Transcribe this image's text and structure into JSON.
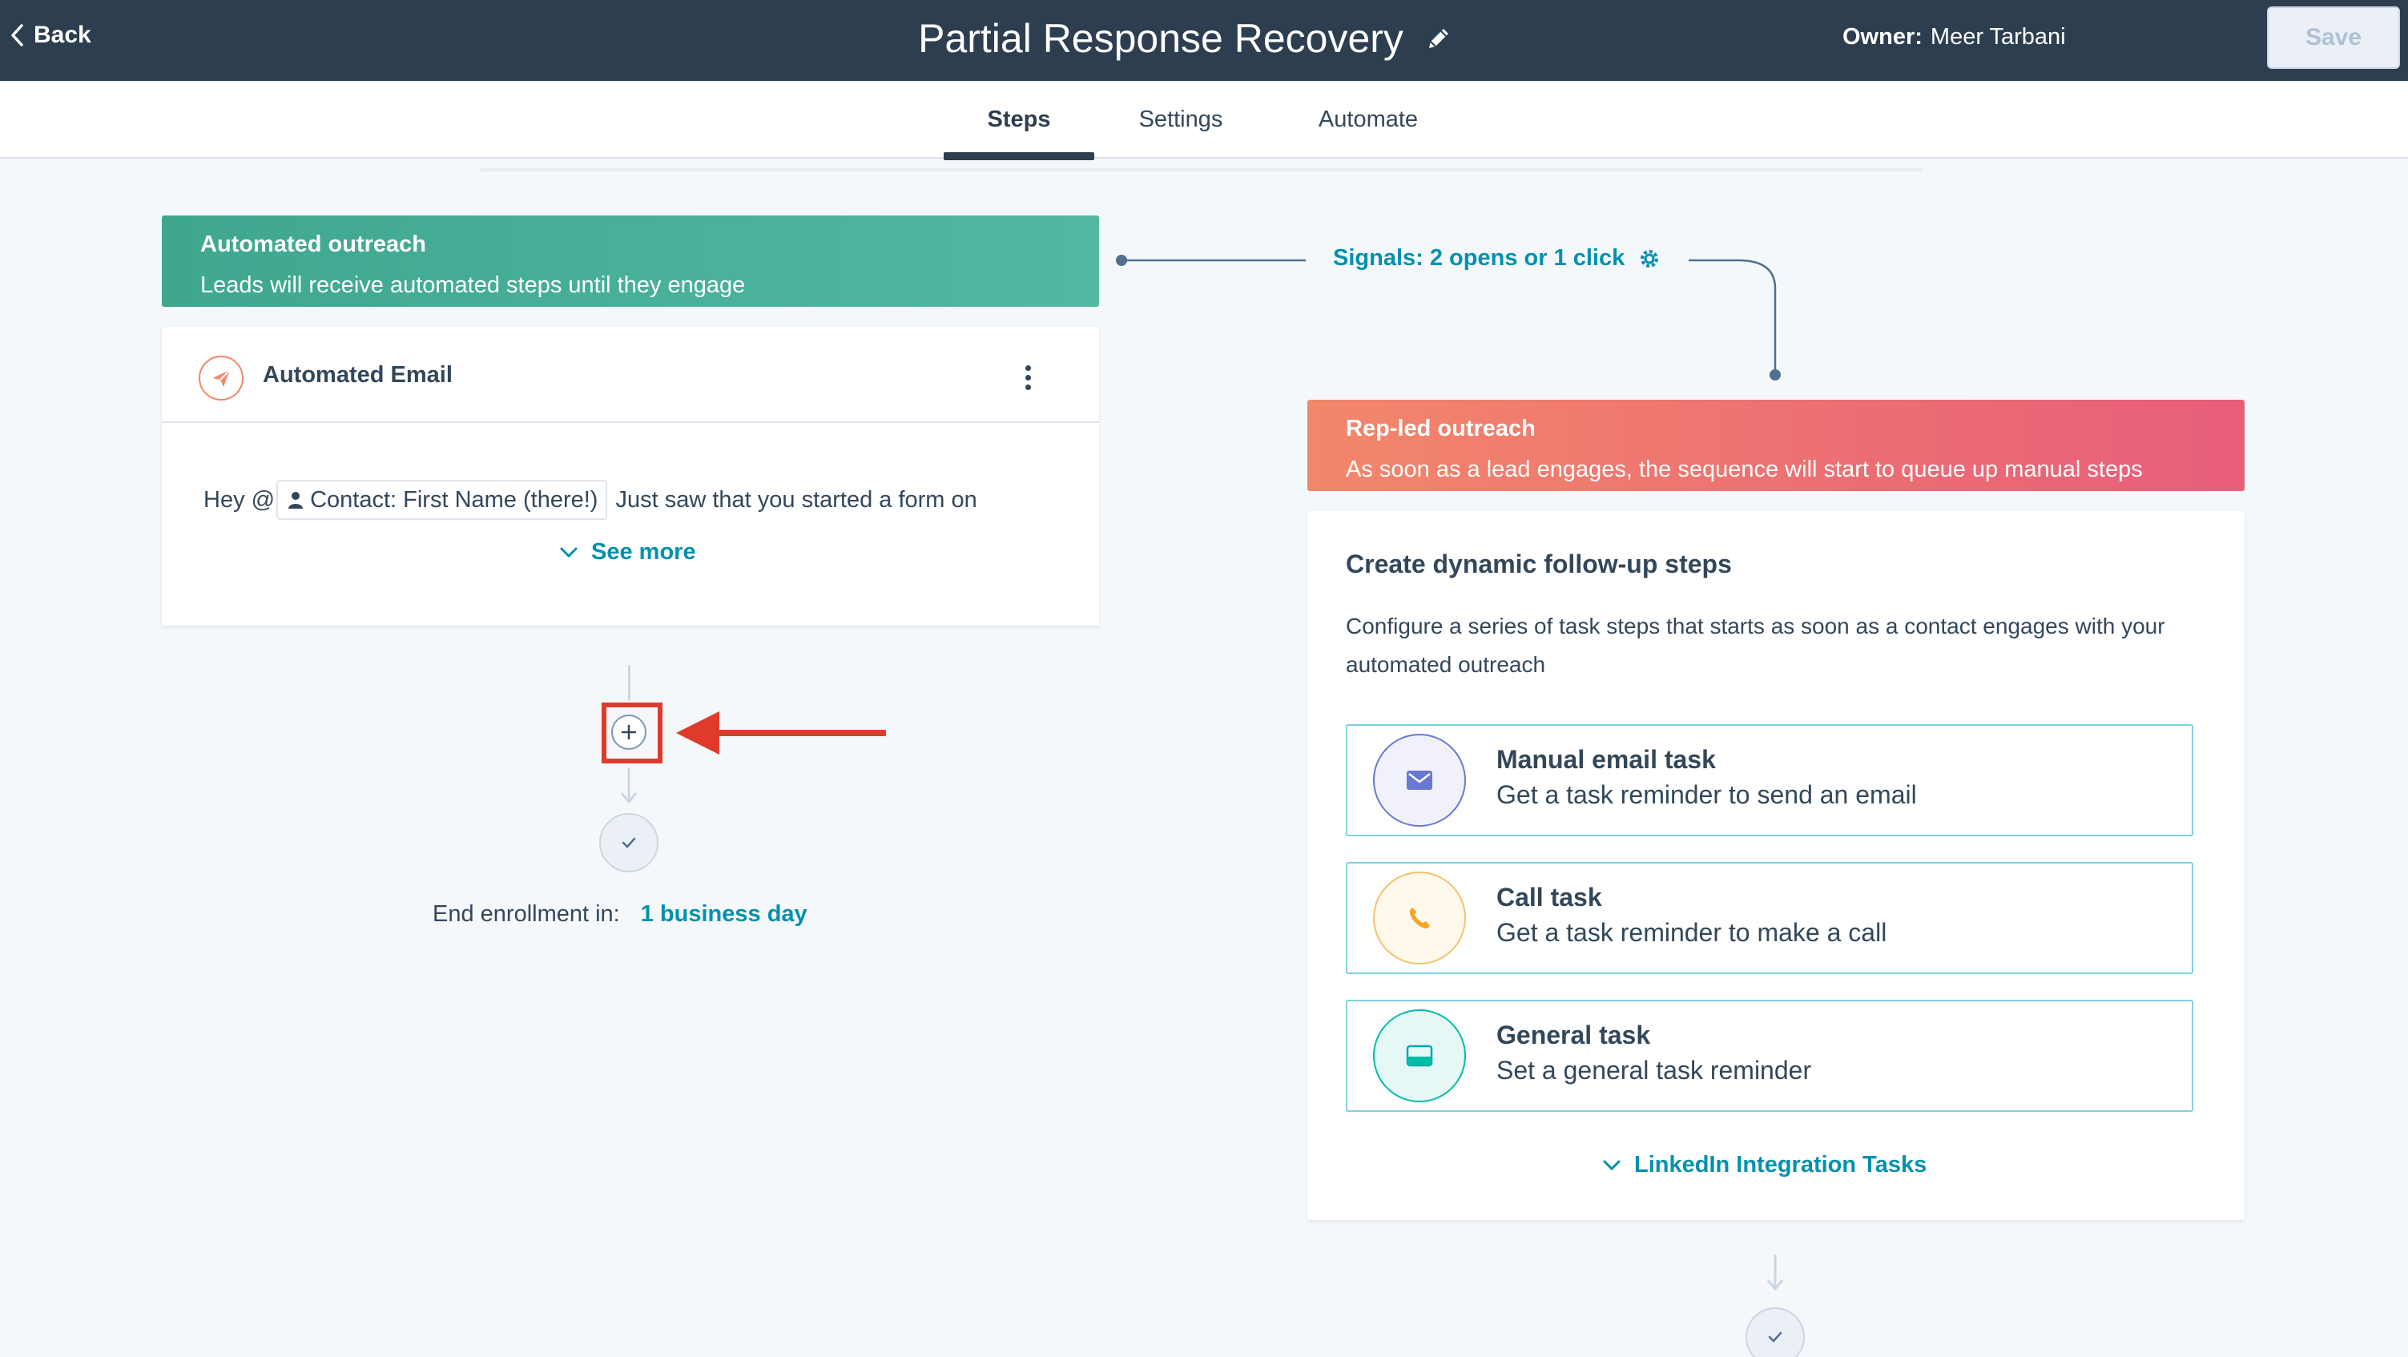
{
  "topbar": {
    "back_label": "Back",
    "title": "Partial Response Recovery",
    "owner_label": "Owner:",
    "owner_name": "Meer Tarbani",
    "save_label": "Save"
  },
  "tabs": [
    {
      "label": "Steps",
      "active": true
    },
    {
      "label": "Settings",
      "active": false
    },
    {
      "label": "Automate",
      "active": false
    }
  ],
  "automated_outreach": {
    "title": "Automated outreach",
    "description": "Leads will receive automated steps until they engage"
  },
  "email_step": {
    "title": "Automated Email",
    "body_prefix": "Hey @",
    "token_label": "Contact: First Name (there!)",
    "body_suffix": "Just saw that you started a form on",
    "see_more": "See more"
  },
  "end_enrollment": {
    "label": "End enrollment in:",
    "value": "1 business day"
  },
  "signals": {
    "label": "Signals: 2 opens or 1 click"
  },
  "rep_led_outreach": {
    "title": "Rep-led outreach",
    "description": "As soon as a lead engages, the sequence will start to queue up manual steps"
  },
  "dynamic_steps": {
    "title": "Create dynamic follow-up steps",
    "description": "Configure a series of task steps that starts as soon as a contact engages with your automated outreach",
    "tasks": [
      {
        "title": "Manual email task",
        "description": "Get a task reminder to send an email",
        "icon": "envelope-icon",
        "color": "#6a78d1"
      },
      {
        "title": "Call task",
        "description": "Get a task reminder to make a call",
        "icon": "phone-icon",
        "color": "#f5c26b"
      },
      {
        "title": "General task",
        "description": "Set a general task reminder",
        "icon": "task-icon",
        "color": "#00bda5"
      }
    ],
    "linkedin_label": "LinkedIn Integration Tasks"
  },
  "colors": {
    "nav_bg": "#2d3e50",
    "link": "#0091ae",
    "automated_banner": "#45ae95",
    "rep_banner": "#ea6e73",
    "highlight_red": "#e03a2c"
  }
}
